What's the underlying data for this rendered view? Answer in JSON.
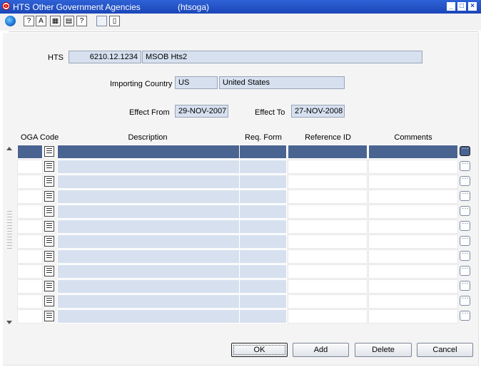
{
  "window": {
    "title": "HTS Other Government Agencies",
    "form_name": "(htsoga)"
  },
  "toolbar": {
    "icons": [
      "globe-icon",
      "help-icon",
      "spellcheck-icon",
      "calculator-icon",
      "print-icon",
      "info-icon",
      "blank-icon",
      "new-document-icon"
    ]
  },
  "form": {
    "hts_label": "HTS",
    "hts_code": "6210.12.1234",
    "hts_desc": "MSOB Hts2",
    "importing_country_label": "Importing Country",
    "country_code": "US",
    "country_name": "United States",
    "effect_from_label": "Effect From",
    "effect_from": "29-NOV-2007",
    "effect_to_label": "Effect To",
    "effect_to": "27-NOV-2008"
  },
  "grid": {
    "columns": [
      "OGA Code",
      "Description",
      "Req. Form",
      "Reference ID",
      "Comments"
    ],
    "row_count": 12,
    "selected_row": 0
  },
  "buttons": {
    "ok": "OK",
    "add": "Add",
    "delete": "Delete",
    "cancel": "Cancel"
  }
}
